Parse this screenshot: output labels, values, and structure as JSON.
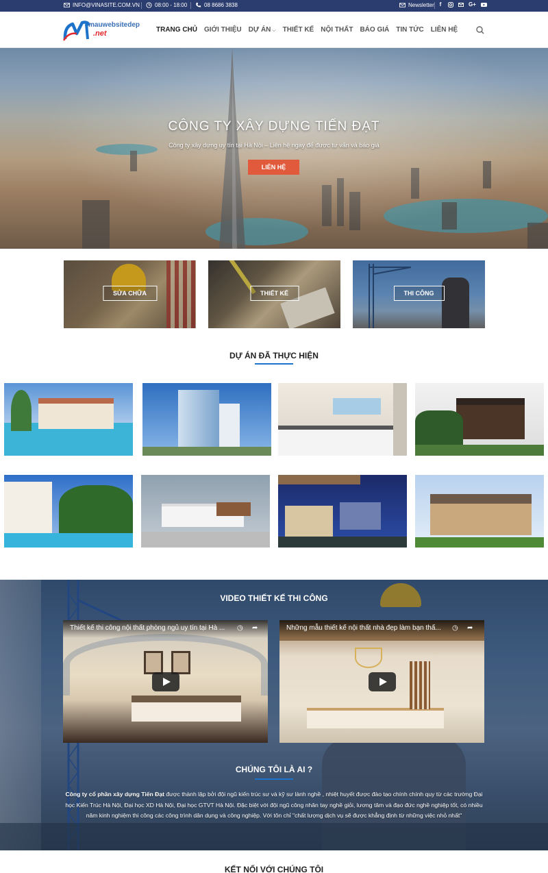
{
  "topbar": {
    "email": "INFO@VINASITE.COM.VN",
    "hours": "08:00 - 18:00",
    "phone": "08 8686 3838",
    "newsletter": "Newsletter",
    "social_icons": [
      "facebook-icon",
      "instagram-icon",
      "email-icon",
      "google-plus-icon",
      "youtube-icon"
    ]
  },
  "header": {
    "logo_text_top": "mauwebsitedep",
    "logo_text_bottom": ".net",
    "nav": [
      {
        "label": "TRANG CHỦ",
        "active": true
      },
      {
        "label": "GIỚI THIỆU"
      },
      {
        "label": "DỰ ÁN",
        "has_dropdown": true
      },
      {
        "label": "THIẾT KẾ"
      },
      {
        "label": "NỘI THẤT"
      },
      {
        "label": "BÁO GIÁ"
      },
      {
        "label": "TIN TỨC"
      },
      {
        "label": "LIÊN HỆ"
      }
    ]
  },
  "hero": {
    "title": "CÔNG TY XÂY DỰNG TIẾN ĐẠT",
    "subtitle": "Công ty xây dựng uy tín tại Hà Nội – Liên hệ ngay để được tư vấn và báo giá",
    "button": "LIÊN HỆ"
  },
  "services": [
    {
      "label": "SỬA CHỮA"
    },
    {
      "label": "THIẾT KẾ"
    },
    {
      "label": "THI CÔNG"
    }
  ],
  "projects": {
    "title": "DỰ ÁN ĐÃ THỰC HIỆN"
  },
  "videos": {
    "title": "VIDEO THIẾT KẾ THI CÔNG",
    "items": [
      {
        "title": "Thiết kế thi công nội thất phòng ngủ uy tín tại Hà ..."
      },
      {
        "title": "Những mẫu thiết kế nội thất nhà đẹp làm bạn thấ..."
      }
    ]
  },
  "about": {
    "title": "CHÚNG TÔI LÀ AI ?",
    "company": "Công ty cổ phần xây dựng Tiến Đạt",
    "text": " được thành lập bởi đội ngũ kiến trúc sư và kỹ sư lành nghề , nhiệt huyết được đào tạo chính chính quy từ các trường Đại học Kiến Trúc Hà Nội, Đại học XD Hà Nội, Đại học GTVT Hà Nội. Đặc biệt với đội ngũ công nhân tay nghề giỏi, lương tâm và đạo đức nghề nghiệp tốt, có nhiều năm kinh nghiệm thi công các công trình dân dụng và công nghiệp. Với tôn chỉ \"chất lượng dịch vụ sẽ được khẳng định từ những việc nhỏ nhất\""
  },
  "next_section_peek": "KẾT NỐI VỚI CHÚNG TÔI"
}
